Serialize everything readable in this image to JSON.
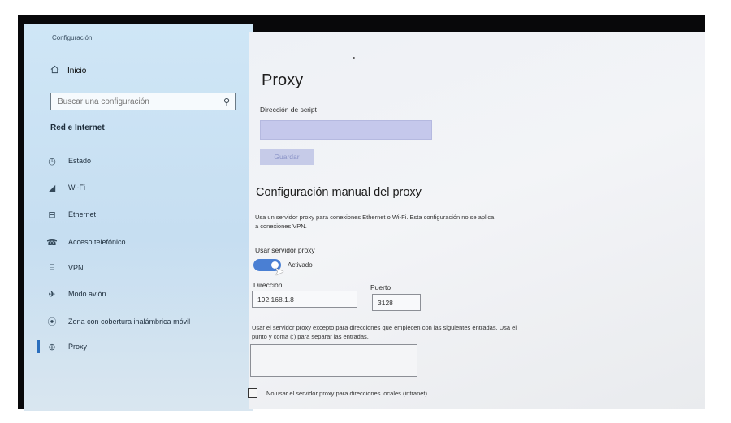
{
  "sidebar": {
    "app_title": "Configuración",
    "home": {
      "label": "Inicio",
      "icon": "home-icon"
    },
    "search": {
      "placeholder": "Buscar una configuración",
      "icon": "search-icon"
    },
    "section_title": "Red e Internet",
    "items": [
      {
        "label": "Estado",
        "icon": "status-globe-icon",
        "active": false
      },
      {
        "label": "Wi-Fi",
        "icon": "wifi-icon",
        "active": false
      },
      {
        "label": "Ethernet",
        "icon": "ethernet-icon",
        "active": false
      },
      {
        "label": "Acceso telefónico",
        "icon": "dialup-icon",
        "active": false
      },
      {
        "label": "VPN",
        "icon": "vpn-icon",
        "active": false
      },
      {
        "label": "Modo avión",
        "icon": "airplane-icon",
        "active": false
      },
      {
        "label": "Zona con cobertura inalámbrica móvil",
        "icon": "hotspot-icon",
        "active": false
      },
      {
        "label": "Proxy",
        "icon": "globe-icon",
        "active": true
      }
    ]
  },
  "main": {
    "page_title": "Proxy",
    "script_label": "Dirección de script",
    "script_value": "",
    "save_label": "Guardar",
    "manual_title": "Configuración manual del proxy",
    "manual_desc": "Usa un servidor proxy para conexiones Ethernet o Wi-Fi. Esta configuración no se aplica a conexiones VPN.",
    "use_proxy_label": "Usar servidor proxy",
    "toggle_state": "Activado",
    "toggle_on": true,
    "address_label": "Dirección",
    "address_value": "192.168.1.8",
    "port_label": "Puerto",
    "port_value": "3128",
    "exceptions_desc": "Usar el servidor proxy excepto para direcciones que empiecen con las siguientes entradas. Usa el punto y coma (;) para separar las entradas.",
    "exceptions_value": "",
    "local_checkbox_label": "No usar el servidor proxy para direcciones locales (intranet)",
    "local_checkbox_checked": false
  },
  "colors": {
    "sidebar_bg": "#c9e1f3",
    "accent": "#4a7fd3",
    "script_field": "#c5c8ec"
  }
}
